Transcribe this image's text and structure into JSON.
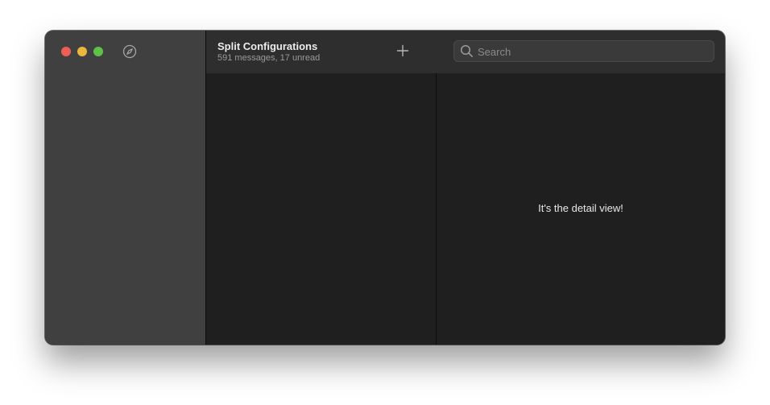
{
  "window": {
    "traffic_lights": {
      "close_color": "#ec5f57",
      "minimize_color": "#e8b83e",
      "maximize_color": "#5fc148"
    },
    "sidebar": {
      "icon": "compass-icon"
    }
  },
  "toolbar": {
    "title": "Split Configurations",
    "subtitle": "591 messages, 17 unread",
    "add_icon": "plus-icon",
    "search": {
      "icon": "search-icon",
      "placeholder": "Search",
      "value": ""
    }
  },
  "detail": {
    "text": "It's the detail view!"
  }
}
